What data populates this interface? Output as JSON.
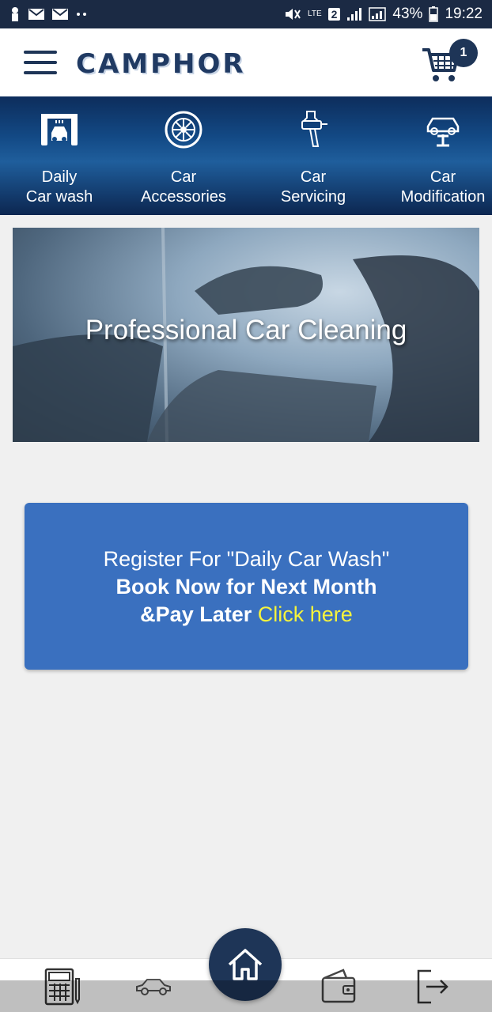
{
  "status_bar": {
    "battery": "43%",
    "time": "19:22",
    "sim_slot": "2",
    "network": "LTE"
  },
  "header": {
    "logo_text": "CAMPHOR",
    "cart_count": "1"
  },
  "categories": [
    {
      "label": "Daily\nCar wash",
      "icon": "car-wash-icon"
    },
    {
      "label": "Car\nAccessories",
      "icon": "tyre-icon"
    },
    {
      "label": "Car\nServicing",
      "icon": "spray-gun-icon"
    },
    {
      "label": "Car\nModification",
      "icon": "car-lift-icon"
    }
  ],
  "banner": {
    "title": "Professional Car Cleaning"
  },
  "register_card": {
    "line1": "Register For \"Daily Car Wash\"",
    "line2": "Book Now for Next Month",
    "line3": "&Pay Later",
    "link": "Click here"
  },
  "bottom_nav": [
    {
      "icon": "calculator-icon"
    },
    {
      "icon": "car-icon"
    },
    {
      "icon": "home-icon"
    },
    {
      "icon": "wallet-icon"
    },
    {
      "icon": "logout-icon"
    }
  ],
  "colors": {
    "primary": "#1e3557",
    "card": "#3a70bf",
    "link": "#f6f33c",
    "background": "#f0f0f0"
  }
}
